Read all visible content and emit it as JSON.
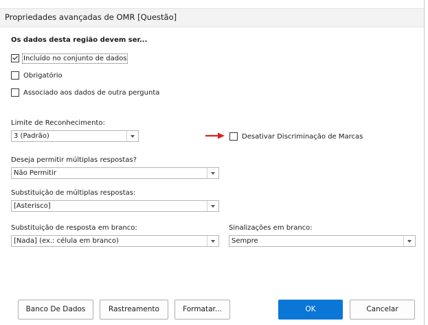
{
  "window": {
    "title": "Propriedades avançadas de OMR [Questão]"
  },
  "section": {
    "heading": "Os dados desta região devem ser...",
    "checkboxes": [
      {
        "label": "Incluído no conjunto de dados",
        "checked": true
      },
      {
        "label": "Obrigatório",
        "checked": false
      },
      {
        "label": "Associado aos dados de outra pergunta",
        "checked": false
      }
    ]
  },
  "recognition": {
    "label": "Limite de Reconhecimento:",
    "value": "3 (Padrão)"
  },
  "disable_mark": {
    "label": "Desativar Discriminação de Marcas",
    "checked": false
  },
  "multiple": {
    "label": "Deseja permitir múltiplas respostas?",
    "value": "Não Permitir"
  },
  "substitution": {
    "label": "Substituição de múltiplas respostas:",
    "value": "[Asterisco]"
  },
  "blank_substitution": {
    "label": "Substituição de resposta em branco:",
    "value": "[Nada] (ex.: célula em branco)"
  },
  "blank_flags": {
    "label": "Sinalizações em branco:",
    "value": "Sempre"
  },
  "buttons": {
    "database": "Banco De Dados",
    "tracking": "Rastreamento",
    "format": "Formatar...",
    "ok": "OK",
    "cancel": "Cancelar"
  },
  "colors": {
    "accent": "#0a77d6",
    "arrow": "#e0201c"
  }
}
